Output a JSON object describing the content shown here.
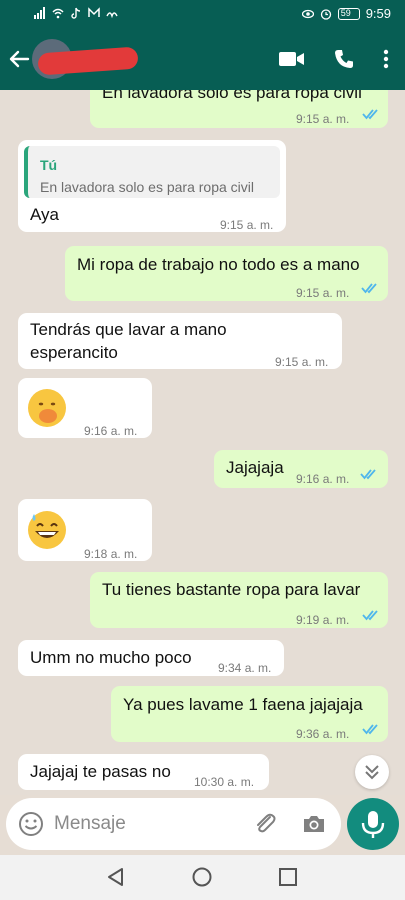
{
  "statusbar": {
    "battery": "59",
    "time": "9:59"
  },
  "header": {
    "contact_name": ""
  },
  "messages": [
    {
      "type": "out",
      "text": "En lavadora solo es para ropa civil",
      "time": "9:15 a. m."
    },
    {
      "type": "in",
      "quote_name": "Tú",
      "quote_text": "En lavadora solo es para ropa civil",
      "text": "Aya",
      "time": "9:15 a. m."
    },
    {
      "type": "out",
      "text": "Mi ropa de trabajo no todo es a mano",
      "time": "9:15 a. m."
    },
    {
      "type": "in",
      "text_line1": "Tendrás que lavar a mano",
      "text_line2": "esperancito",
      "time": "9:15 a. m."
    },
    {
      "type": "in",
      "emoji": "hand-over-mouth",
      "time": "9:16 a. m."
    },
    {
      "type": "out",
      "text": "Jajajaja",
      "time": "9:16 a. m."
    },
    {
      "type": "in",
      "emoji": "grinning-sweat",
      "time": "9:18 a. m."
    },
    {
      "type": "out",
      "text": "Tu tienes bastante ropa para lavar",
      "time": "9:19 a. m."
    },
    {
      "type": "in",
      "text": "Umm no mucho poco",
      "time": "9:34 a. m."
    },
    {
      "type": "out",
      "text": "Ya pues lavame 1 faena jajajaja",
      "time": "9:36 a. m."
    },
    {
      "type": "in",
      "text": "Jajajaj te pasas no",
      "time": "10:30 a. m."
    }
  ],
  "composer": {
    "placeholder": "Mensaje"
  },
  "colors": {
    "header": "#075e54",
    "outgoing": "#e2fcc9",
    "incoming": "#ffffff",
    "accent": "#128c7e",
    "read_ticks": "#4fb6ec"
  }
}
